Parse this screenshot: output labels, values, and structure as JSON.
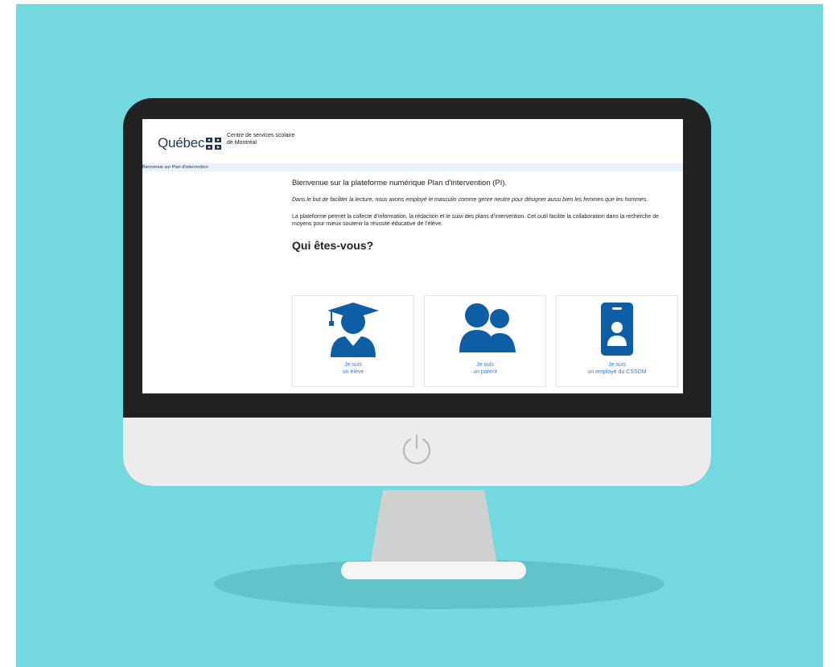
{
  "colors": {
    "backdrop": "#74d8df",
    "bezel": "#222222",
    "chin": "#ececec",
    "brand_blue": "#223654",
    "icon_blue": "#0e5ea6",
    "link_blue": "#3a7bd5",
    "breadcrumb_bg": "#e9f0f9"
  },
  "header": {
    "logo_text": "Québec",
    "logo_icon": "fleur-de-lis-flag-icon",
    "org_line1": "Centre de services scolaire",
    "org_line2": "de Montréal"
  },
  "breadcrumb": "Bienvenue sur Plan d'intervention",
  "main": {
    "welcome": "Bienvenue sur la plateforme numérique Plan d’intervention (PI).",
    "note": "Dans le but de faciliter la lecture, nous avons employé le masculin comme genre neutre pour désigner aussi bien les femmes que les hommes.",
    "description": "La plateforme permet la collecte d’information, la rédaction et le suivi des plans d’intervention. Cet outil facilite la collaboration dans la recherche de moyens pour mieux soutenir la réussite éducative de l’élève.",
    "question": "Qui êtes-vous?"
  },
  "roles": [
    {
      "icon": "graduate-student-icon",
      "line1": "Je suis",
      "line2": "un élève"
    },
    {
      "icon": "parent-icon",
      "line1": "Je suis",
      "line2": "un parent"
    },
    {
      "icon": "employee-badge-icon",
      "line1": "Je suis",
      "line2": "un employé du CSSDM"
    }
  ],
  "monitor": {
    "power_icon": "power-icon"
  }
}
